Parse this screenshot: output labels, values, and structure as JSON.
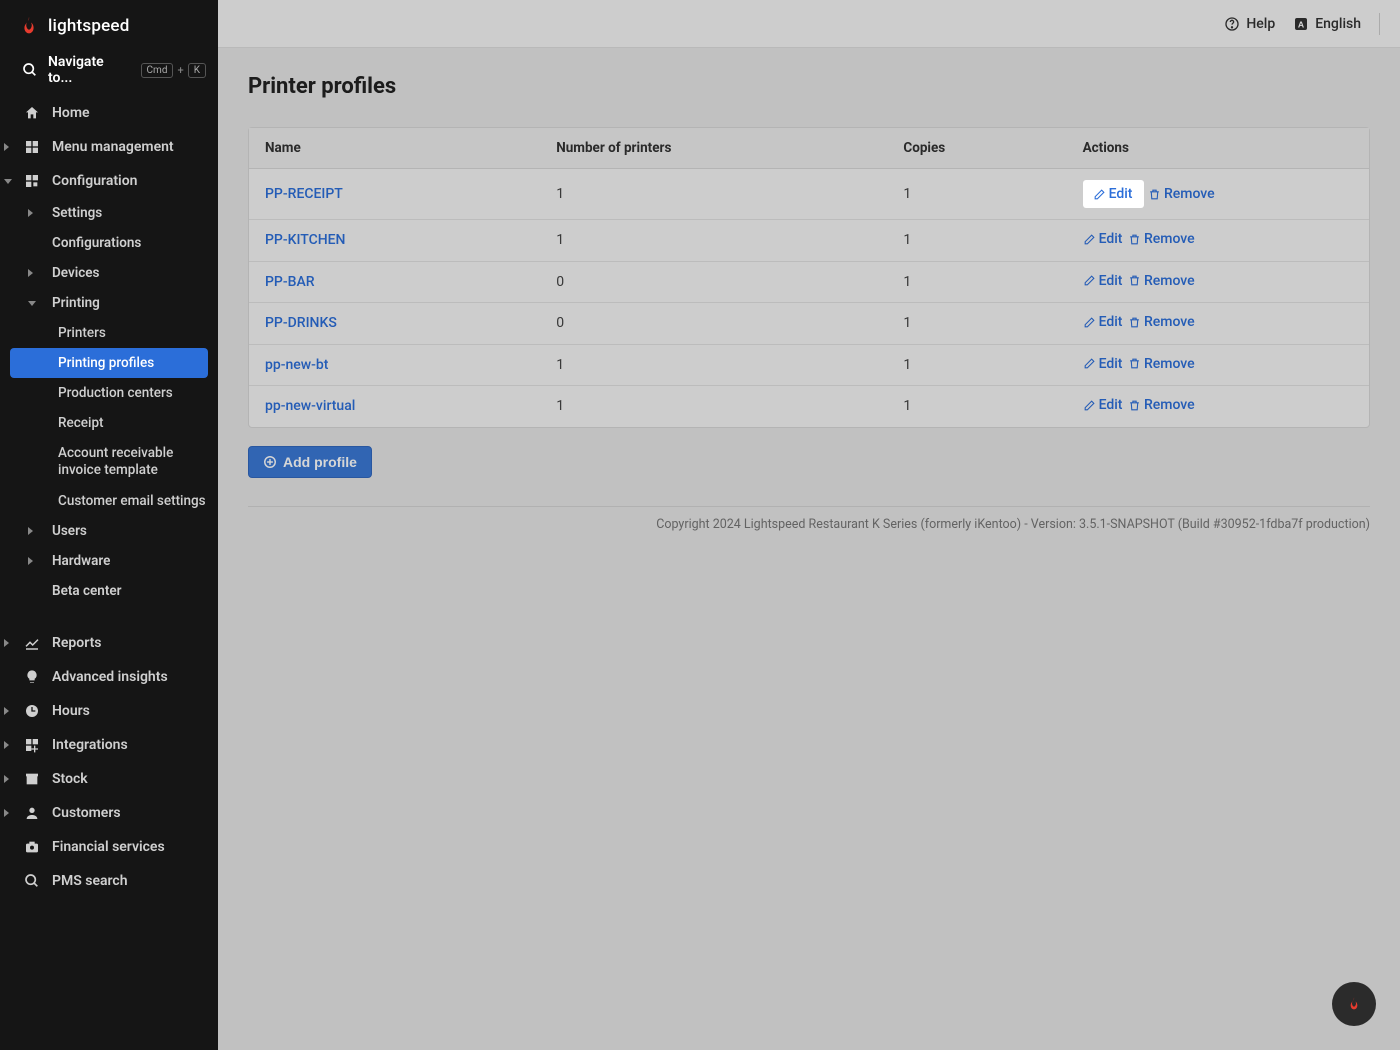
{
  "brand": {
    "name": "lightspeed"
  },
  "search": {
    "placeholder": "Navigate to...",
    "kbd1": "Cmd",
    "kbd_plus": "+",
    "kbd2": "K"
  },
  "topbar": {
    "help": "Help",
    "language": "English"
  },
  "sidebar": {
    "home": "Home",
    "menu_management": "Menu management",
    "configuration": "Configuration",
    "settings": "Settings",
    "configurations": "Configurations",
    "devices": "Devices",
    "printing": "Printing",
    "printers": "Printers",
    "printing_profiles": "Printing profiles",
    "production_centers": "Production centers",
    "receipt": "Receipt",
    "ar_invoice_template": "Account receivable invoice template",
    "customer_email_settings": "Customer email settings",
    "users": "Users",
    "hardware": "Hardware",
    "beta_center": "Beta center",
    "reports": "Reports",
    "advanced_insights": "Advanced insights",
    "hours": "Hours",
    "integrations": "Integrations",
    "stock": "Stock",
    "customers": "Customers",
    "financial_services": "Financial services",
    "pms_search": "PMS search"
  },
  "page": {
    "title": "Printer profiles",
    "add_profile": "Add profile",
    "footer": "Copyright 2024 Lightspeed Restaurant K Series (formerly iKentoo) - Version: 3.5.1-SNAPSHOT (Build #30952-1fdba7f production)"
  },
  "table": {
    "columns": {
      "name": "Name",
      "num_printers": "Number of printers",
      "copies": "Copies",
      "actions": "Actions"
    },
    "edit_label": "Edit",
    "remove_label": "Remove",
    "rows": [
      {
        "name": "PP-RECEIPT",
        "printers": "1",
        "copies": "1"
      },
      {
        "name": "PP-KITCHEN",
        "printers": "1",
        "copies": "1"
      },
      {
        "name": "PP-BAR",
        "printers": "0",
        "copies": "1"
      },
      {
        "name": "PP-DRINKS",
        "printers": "0",
        "copies": "1"
      },
      {
        "name": "pp-new-bt",
        "printers": "1",
        "copies": "1"
      },
      {
        "name": "pp-new-virtual",
        "printers": "1",
        "copies": "1"
      }
    ]
  }
}
